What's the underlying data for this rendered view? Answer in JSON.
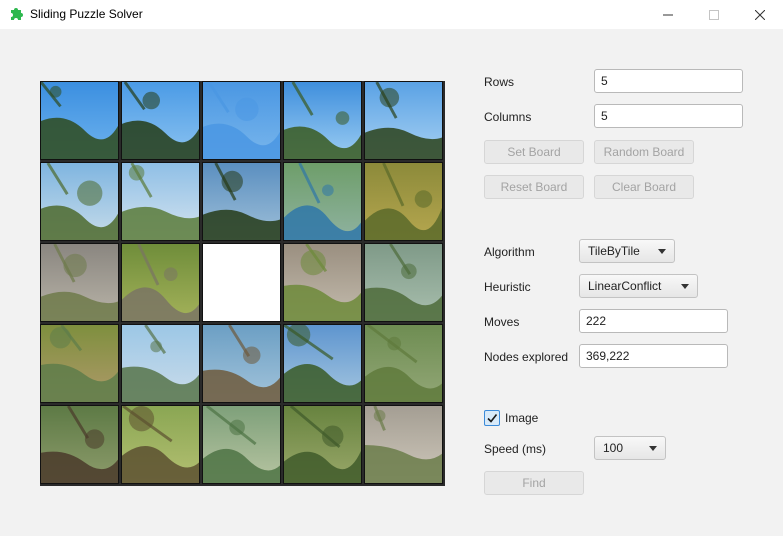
{
  "window": {
    "title": "Sliding Puzzle Solver",
    "app_icon": "puzzle-piece-icon",
    "controls": [
      "minimize-icon",
      "maximize-icon",
      "close-icon"
    ]
  },
  "board": {
    "rows": 5,
    "columns": 5,
    "empty_tile": {
      "row": 2,
      "col": 2
    },
    "tile_images": "landscape photo fragments"
  },
  "controls": {
    "rows_label": "Rows",
    "rows_value": "5",
    "columns_label": "Columns",
    "columns_value": "5",
    "set_board": "Set Board",
    "random_board": "Random Board",
    "reset_board": "Reset Board",
    "clear_board": "Clear Board",
    "algorithm_label": "Algorithm",
    "algorithm_value": "TileByTile",
    "heuristic_label": "Heuristic",
    "heuristic_value": "LinearConflict",
    "moves_label": "Moves",
    "moves_value": "222",
    "nodes_label": "Nodes explored",
    "nodes_value": "369,222",
    "image_label": "Image",
    "image_checked": true,
    "speed_label": "Speed (ms)",
    "speed_value": "100",
    "find": "Find"
  },
  "colors": {
    "accent": "#3c8bd9",
    "disabled_text": "#a3a3a3"
  }
}
